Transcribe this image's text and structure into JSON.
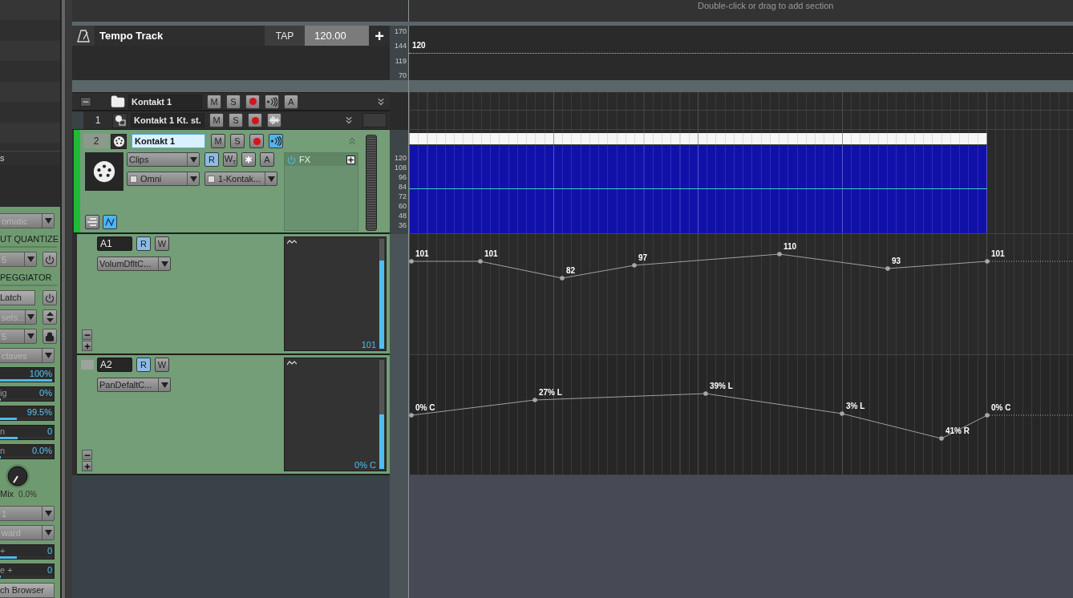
{
  "browser_list": {
    "items": [
      {
        "label": "s"
      }
    ]
  },
  "inspector": {
    "controls": [
      {
        "kind": "dropdown",
        "value": "omatic",
        "disabled": true
      },
      {
        "kind": "heading",
        "label": "UT QUANTIZE"
      },
      {
        "kind": "dropdown_power",
        "value": "5",
        "disabled": true
      },
      {
        "kind": "heading",
        "label": "PEGGIATOR"
      },
      {
        "kind": "button_power",
        "label": "Latch"
      },
      {
        "kind": "dropdown_spin",
        "value": "sets...",
        "disabled": true
      },
      {
        "kind": "dropdown_lock",
        "value": "5",
        "disabled": true
      },
      {
        "kind": "dropdown",
        "value": "ctaves",
        "disabled": true
      },
      {
        "kind": "slider",
        "value": "100%",
        "level": 1
      },
      {
        "kind": "slider",
        "label": "ig",
        "value": "0%",
        "level": 0
      },
      {
        "kind": "slider",
        "value": "99.5%",
        "level": 0.32
      },
      {
        "kind": "slider",
        "label": "n",
        "value": "0",
        "level": 0.34
      },
      {
        "kind": "slider",
        "label": "n",
        "value": "0.0%",
        "level": 0
      },
      {
        "kind": "knob",
        "label": "Mix",
        "value": "0.0%"
      },
      {
        "kind": "dropdown",
        "value": "1",
        "disabled": true
      },
      {
        "kind": "dropdown",
        "value": "ward",
        "disabled": true
      },
      {
        "kind": "slider",
        "label": "+",
        "value": "0",
        "level": 0.33
      },
      {
        "kind": "slider",
        "label": "e +",
        "value": "0",
        "level": 0
      },
      {
        "kind": "button",
        "label": "ch Browser"
      }
    ]
  },
  "section_bar": {
    "hint": "Double-click or drag to add section"
  },
  "tempo_track": {
    "title": "Tempo Track",
    "tap": "TAP",
    "bpm": "120.00",
    "add": "+",
    "scale": [
      "170",
      "144",
      "119",
      "70"
    ],
    "value_label": "120"
  },
  "folder_track": {
    "name": "Kontakt 1",
    "selected": false,
    "buttons": [
      {
        "kind": "mute",
        "label": "M",
        "on": false
      },
      {
        "kind": "solo",
        "label": "S",
        "on": false
      },
      {
        "kind": "record",
        "on": false
      },
      {
        "kind": "echo",
        "on": false
      },
      {
        "kind": "archive",
        "label": "A",
        "on": false
      }
    ]
  },
  "tracks": [
    {
      "number": "1",
      "name": "Kontakt 1 Kt. st.",
      "selected": false,
      "buttons": [
        {
          "kind": "mute",
          "label": "M",
          "on": false
        },
        {
          "kind": "solo",
          "label": "S",
          "on": false
        },
        {
          "kind": "record",
          "on": false
        },
        {
          "kind": "waveform"
        }
      ]
    },
    {
      "number": "2",
      "name": "Kontakt 1",
      "selected": true,
      "buttons": [
        {
          "kind": "mute",
          "label": "M",
          "on": false
        },
        {
          "kind": "solo",
          "label": "S",
          "on": false
        },
        {
          "kind": "record",
          "on": false
        },
        {
          "kind": "echo",
          "on": true
        }
      ],
      "input_mode": "Clips",
      "input": "Omni",
      "output": "1-Kontak...",
      "mode_buttons": [
        {
          "kind": "read",
          "label": "R",
          "on": true
        },
        {
          "kind": "write",
          "label": "W$_{T}$",
          "on": false
        },
        {
          "kind": "quantize",
          "on": false
        },
        {
          "kind": "archive",
          "label": "A",
          "on": false
        }
      ],
      "fx": {
        "label": "FX",
        "on": true
      },
      "tools": [
        {
          "kind": "lanes",
          "on": false
        },
        {
          "kind": "automation",
          "on": true
        }
      ],
      "scale": [
        "120",
        "108",
        "96",
        "84",
        "72",
        "60",
        "48",
        "36"
      ]
    }
  ],
  "automation_lanes": [
    {
      "name": "A1",
      "buttons": [
        {
          "kind": "read",
          "label": "R",
          "on": true
        },
        {
          "kind": "write",
          "label": "W",
          "on": false
        }
      ],
      "parameter": "VolumDfltC...",
      "readout": "101",
      "level": 0.8,
      "points": [
        {
          "label": "101"
        },
        {
          "label": "101"
        },
        {
          "label": "82"
        },
        {
          "label": "97"
        },
        {
          "label": "110"
        },
        {
          "label": "93"
        },
        {
          "label": "101"
        }
      ]
    },
    {
      "name": "A2",
      "color": "#9ba39b",
      "buttons": [
        {
          "kind": "read",
          "label": "R",
          "on": true
        },
        {
          "kind": "write",
          "label": "W",
          "on": false
        }
      ],
      "parameter": "PanDefaltC...",
      "readout": "0% C",
      "level": 0.5,
      "points": [
        {
          "label": "0% C"
        },
        {
          "label": "27% L"
        },
        {
          "label": "39% L"
        },
        {
          "label": "3% L"
        },
        {
          "label": "41% R"
        },
        {
          "label": "0% C"
        }
      ]
    }
  ]
}
